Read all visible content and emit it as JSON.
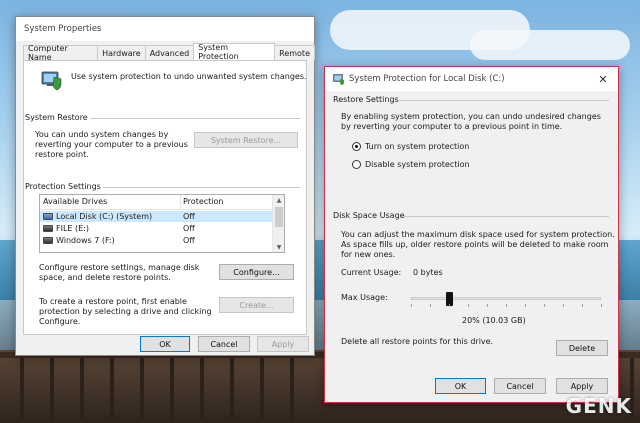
{
  "system_properties": {
    "title": "System Properties",
    "tabs": [
      "Computer Name",
      "Hardware",
      "Advanced",
      "System Protection",
      "Remote"
    ],
    "active_tab": "System Protection",
    "intro_text": "Use system protection to undo unwanted system changes.",
    "restore": {
      "heading": "System Restore",
      "description": "You can undo system changes by reverting your computer to a previous restore point.",
      "button": "System Restore..."
    },
    "protection": {
      "heading": "Protection Settings",
      "columns": [
        "Available Drives",
        "Protection"
      ],
      "drives": [
        {
          "name": "Local Disk (C:) (System)",
          "protection": "Off",
          "icon": "system-drive-icon",
          "selected": true
        },
        {
          "name": "FILE (E:)",
          "protection": "Off",
          "icon": "hdd-icon",
          "selected": false
        },
        {
          "name": "Windows 7 (F:)",
          "protection": "Off",
          "icon": "hdd-icon",
          "selected": false
        }
      ],
      "configure_text": "Configure restore settings, manage disk space, and delete restore points.",
      "configure_button": "Configure...",
      "create_text": "To create a restore point, first enable protection by selecting a drive and clicking Configure.",
      "create_button": "Create..."
    },
    "buttons": {
      "ok": "OK",
      "cancel": "Cancel",
      "apply": "Apply"
    }
  },
  "system_protection_dialog": {
    "title": "System Protection for Local Disk (C:)",
    "close_glyph": "✕",
    "restore_settings": {
      "heading": "Restore Settings",
      "description": "By enabling system protection, you can undo undesired changes by reverting your computer to a previous point in time.",
      "options": [
        "Turn on system protection",
        "Disable system protection"
      ],
      "selected_option": 0
    },
    "disk_space": {
      "heading": "Disk Space Usage",
      "description": "You can adjust the maximum disk space used for system protection. As space fills up, older restore points will be deleted to make room for new ones.",
      "current_usage_label": "Current Usage:",
      "current_usage_value": "0 bytes",
      "max_usage_label": "Max Usage:",
      "max_usage_value": "20% (10.03 GB)",
      "max_usage_fraction": 0.2,
      "delete_text": "Delete all restore points for this drive.",
      "delete_button": "Delete"
    },
    "buttons": {
      "ok": "OK",
      "cancel": "Cancel",
      "apply": "Apply"
    }
  },
  "watermark": "GENK"
}
